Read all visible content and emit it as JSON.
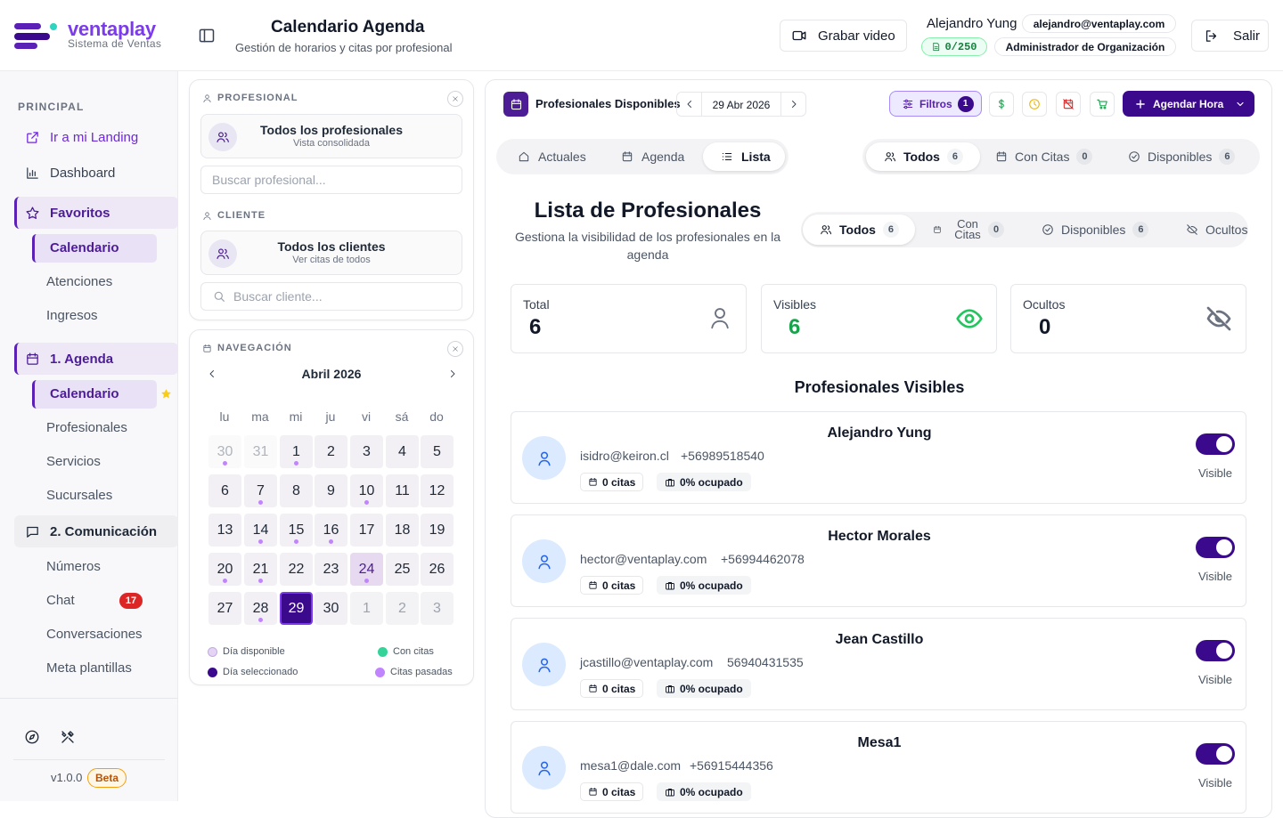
{
  "brand": {
    "name": "ventaplay",
    "subtitle": "Sistema de Ventas"
  },
  "sidebar": {
    "section": "PRINCIPAL",
    "landing": "Ir a mi Landing",
    "dashboard": "Dashboard",
    "favoritos": "Favoritos",
    "fav_items": [
      "Calendario",
      "Atenciones",
      "Ingresos"
    ],
    "agenda": "1. Agenda",
    "agenda_items": [
      "Calendario",
      "Profesionales",
      "Servicios",
      "Sucursales"
    ],
    "comunicacion": "2. Comunicación",
    "com_items": [
      "Números",
      "Chat",
      "Conversaciones",
      "Meta plantillas"
    ],
    "chat_badge": "17",
    "version": "v1.0.0",
    "beta": "Beta"
  },
  "header": {
    "title": "Calendario Agenda",
    "subtitle": "Gestión de horarios y citas por profesional",
    "record_btn": "Grabar video",
    "user_name": "Alejandro Yung",
    "user_email": "alejandro@ventaplay.com",
    "quota": "0/250",
    "role": "Administrador de Organización",
    "logout": "Salir"
  },
  "filters": {
    "prof_label": "PROFESIONAL",
    "prof_title": "Todos los profesionales",
    "prof_sub": "Vista consolidada",
    "prof_search": "Buscar profesional...",
    "client_label": "CLIENTE",
    "client_title": "Todos los clientes",
    "client_sub": "Ver citas de todos",
    "client_search": "Buscar cliente..."
  },
  "calendar": {
    "label": "NAVEGACIÓN",
    "month": "Abril 2026",
    "dow": [
      "lu",
      "ma",
      "mi",
      "ju",
      "vi",
      "sá",
      "do"
    ],
    "weeks": [
      [
        {
          "d": "30",
          "t": "out",
          "dot": true
        },
        {
          "d": "31",
          "t": "out"
        },
        {
          "d": "1",
          "dot": true
        },
        {
          "d": "2"
        },
        {
          "d": "3"
        },
        {
          "d": "4"
        },
        {
          "d": "5"
        }
      ],
      [
        {
          "d": "6"
        },
        {
          "d": "7",
          "dot": true
        },
        {
          "d": "8"
        },
        {
          "d": "9"
        },
        {
          "d": "10",
          "dot": true
        },
        {
          "d": "11"
        },
        {
          "d": "12"
        }
      ],
      [
        {
          "d": "13"
        },
        {
          "d": "14",
          "dot": true
        },
        {
          "d": "15",
          "dot": true
        },
        {
          "d": "16",
          "dot": true
        },
        {
          "d": "17"
        },
        {
          "d": "18"
        },
        {
          "d": "19"
        }
      ],
      [
        {
          "d": "20",
          "dot": true
        },
        {
          "d": "21",
          "dot": true
        },
        {
          "d": "22"
        },
        {
          "d": "23"
        },
        {
          "d": "24",
          "t": "hl",
          "dot": true
        },
        {
          "d": "25"
        },
        {
          "d": "26"
        }
      ],
      [
        {
          "d": "27"
        },
        {
          "d": "28",
          "dot": true
        },
        {
          "d": "29",
          "t": "sel"
        },
        {
          "d": "30"
        },
        {
          "d": "1",
          "t": "dim"
        },
        {
          "d": "2",
          "t": "dim"
        },
        {
          "d": "3",
          "t": "dim"
        }
      ]
    ],
    "legend": [
      {
        "label": "Día disponible",
        "color": "#e4d4f4"
      },
      {
        "label": "Con citas",
        "color": "#34d399"
      },
      {
        "label": "Día seleccionado",
        "color": "#3b0a8c"
      },
      {
        "label": "Citas pasadas",
        "color": "#c084fc"
      }
    ]
  },
  "main": {
    "title": "Profesionales Disponibles",
    "date": "29 Abr 2026",
    "filters_label": "Filtros",
    "filters_count": "1",
    "agendar": "Agendar Hora",
    "view_tabs": [
      "Actuales",
      "Agenda",
      "Lista"
    ],
    "status_tabs": [
      {
        "label": "Todos",
        "count": "6"
      },
      {
        "label": "Con Citas",
        "count": "0"
      },
      {
        "label": "Disponibles",
        "count": "6"
      }
    ],
    "list_title": "Lista de Profesionales",
    "list_subtitle": "Gestiona la visibilidad de los profesionales en la agenda",
    "list_tabs": [
      {
        "label": "Todos",
        "count": "6"
      },
      {
        "label": "Con Citas",
        "count": "0"
      },
      {
        "label": "Disponibles",
        "count": "6"
      },
      {
        "label": "Ocultos"
      }
    ],
    "stats": [
      {
        "label": "Total",
        "value": "6"
      },
      {
        "label": "Visibles",
        "value": "6"
      },
      {
        "label": "Ocultos",
        "value": "0"
      }
    ],
    "section_title": "Profesionales Visibles",
    "professionals": [
      {
        "name": "Alejandro Yung",
        "email": "isidro@keiron.cl",
        "phone": "+56989518540",
        "citas": "0 citas",
        "ocupado": "0% ocupado",
        "status": "Visible"
      },
      {
        "name": "Hector Morales",
        "email": "hector@ventaplay.com",
        "phone": "+56994462078",
        "citas": "0 citas",
        "ocupado": "0% ocupado",
        "status": "Visible"
      },
      {
        "name": "Jean Castillo",
        "email": "jcastillo@ventaplay.com",
        "phone": "56940431535",
        "citas": "0 citas",
        "ocupado": "0% ocupado",
        "status": "Visible"
      },
      {
        "name": "Mesa1",
        "email": "mesa1@dale.com",
        "phone": "+56915444356",
        "citas": "0 citas",
        "ocupado": "0% ocupado",
        "status": "Visible"
      }
    ]
  }
}
